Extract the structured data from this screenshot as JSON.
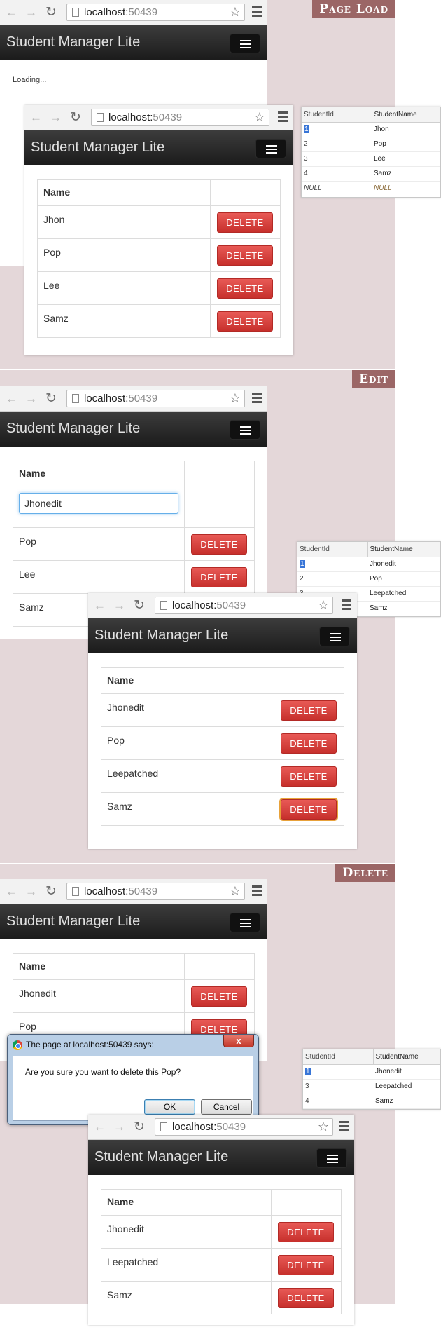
{
  "sections": {
    "page_load": "Page Load",
    "edit": "Edit",
    "delete": "Delete"
  },
  "browser": {
    "host": "localhost:",
    "port": "50439"
  },
  "app": {
    "brand": "Student Manager Lite",
    "loading": "Loading...",
    "name_header": "Name",
    "delete_label": "DELETE"
  },
  "page_load": {
    "students": [
      "Jhon",
      "Pop",
      "Lee",
      "Samz"
    ],
    "db": {
      "headers": [
        "StudentId",
        "StudentName"
      ],
      "rows": [
        [
          "1",
          "Jhon"
        ],
        [
          "2",
          "Pop"
        ],
        [
          "3",
          "Lee"
        ],
        [
          "4",
          "Samz"
        ],
        [
          "NULL",
          "NULL"
        ]
      ]
    }
  },
  "edit": {
    "input_value": "Jhonedit",
    "remaining": [
      "Pop",
      "Lee",
      "Samz"
    ],
    "students_after": [
      "Jhonedit",
      "Pop",
      "Leepatched",
      "Samz"
    ],
    "db": {
      "headers": [
        "StudentId",
        "StudentName"
      ],
      "rows": [
        [
          "1",
          "Jhonedit"
        ],
        [
          "2",
          "Pop"
        ],
        [
          "3",
          "Leepatched"
        ],
        [
          "4",
          "Samz"
        ]
      ]
    }
  },
  "delete": {
    "students_before": [
      "Jhonedit",
      "Pop"
    ],
    "students_after": [
      "Jhonedit",
      "Leepatched",
      "Samz"
    ],
    "dialog": {
      "title": "The page at localhost:50439 says:",
      "message": "Are you sure you want to delete this Pop?",
      "ok": "OK",
      "cancel": "Cancel",
      "close": "x"
    },
    "db": {
      "headers": [
        "StudentId",
        "StudentName"
      ],
      "rows": [
        [
          "1",
          "Jhonedit"
        ],
        [
          "3",
          "Leepatched"
        ],
        [
          "4",
          "Samz"
        ]
      ]
    }
  },
  "icons": {
    "back": "back-arrow-icon",
    "forward": "forward-arrow-icon",
    "reload": "reload-icon",
    "star": "star-icon",
    "menu": "chrome-menu-icon",
    "hamburger": "hamburger-icon"
  }
}
